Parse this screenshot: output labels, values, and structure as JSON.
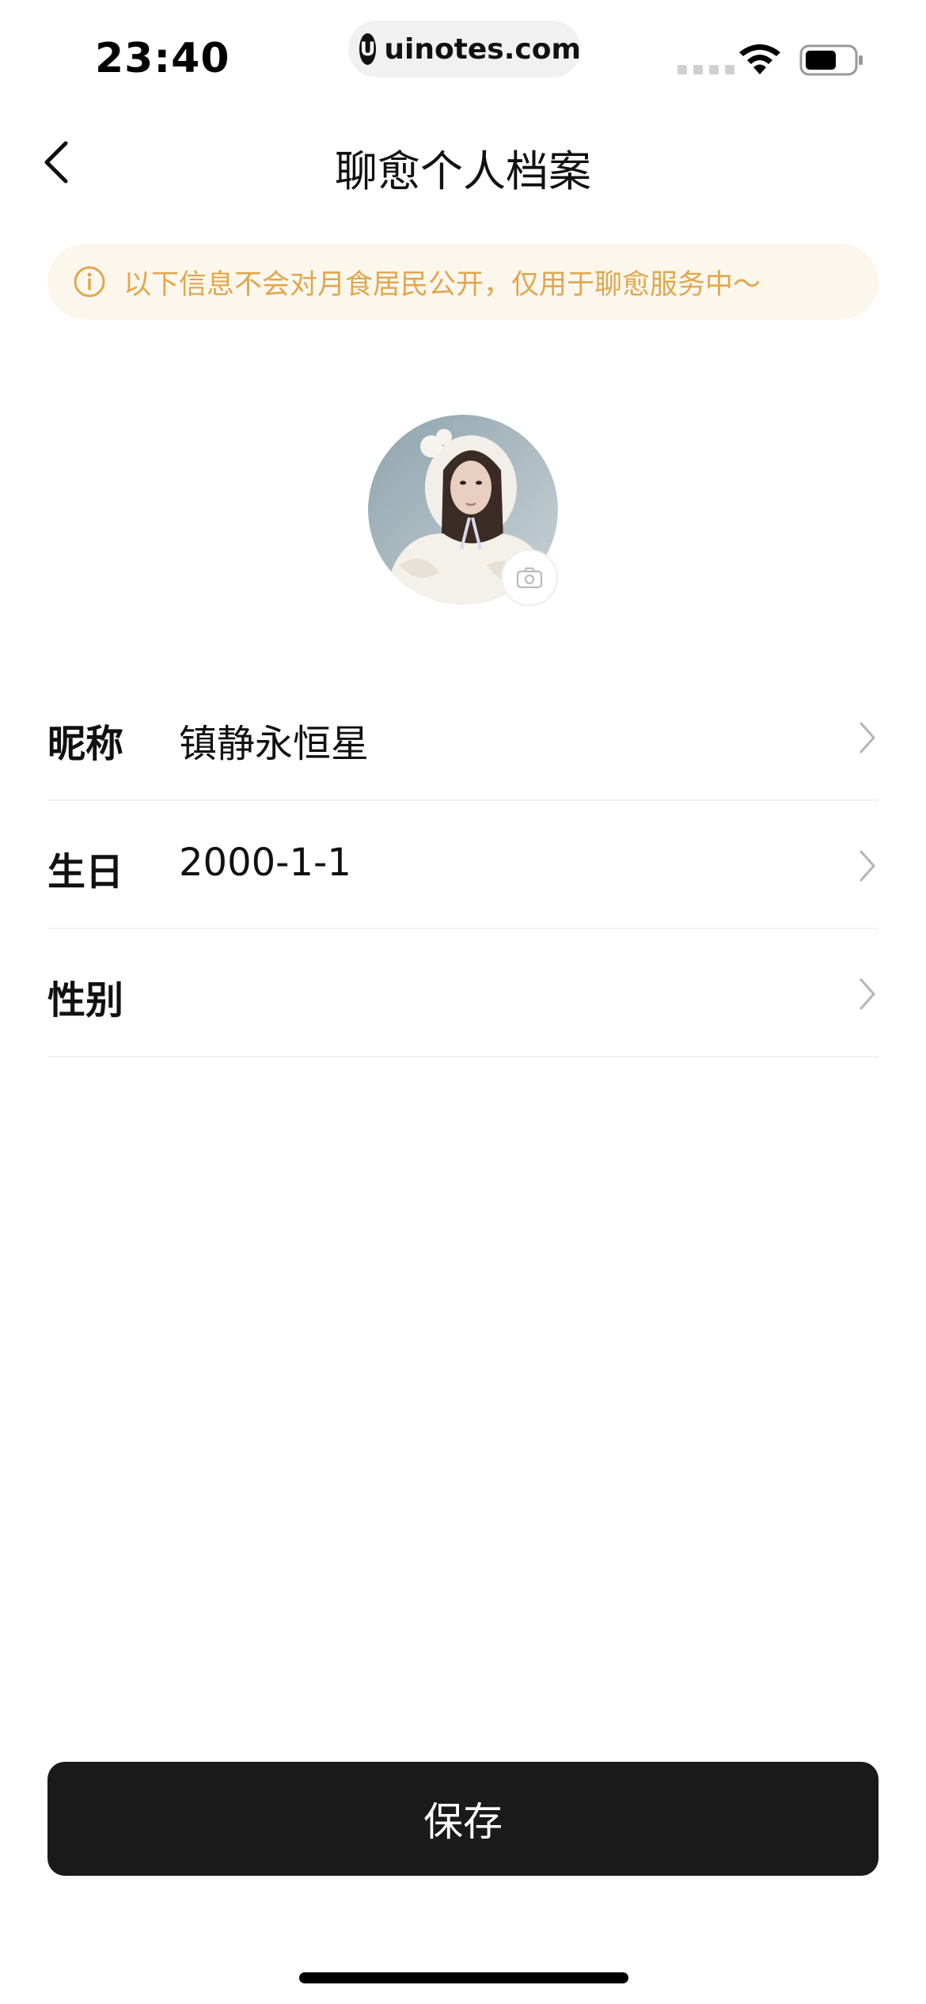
{
  "status_bar": {
    "time": "23:40",
    "url": "uinotes.com",
    "url_logo": "U"
  },
  "nav": {
    "title": "聊愈个人档案",
    "back_icon": "chevron-left-icon"
  },
  "notice": {
    "icon": "info-icon",
    "text": "以下信息不会对月食居民公开，仅用于聊愈服务中～",
    "color": "#e0a74d",
    "background": "#fcf7ed"
  },
  "profile": {
    "avatar_icon": "avatar-photo",
    "camera_icon": "camera-icon"
  },
  "form": {
    "rows": [
      {
        "label": "昵称",
        "value": "镇静永恒星"
      },
      {
        "label": "生日",
        "value": "2000-1-1"
      },
      {
        "label": "性别",
        "value": ""
      }
    ]
  },
  "actions": {
    "save_label": "保存",
    "save_color": "#1a1a1a"
  }
}
